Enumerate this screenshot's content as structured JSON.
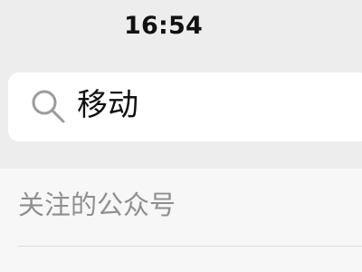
{
  "status_bar": {
    "time": "16:54"
  },
  "search": {
    "query": "移动",
    "icon": "search-icon"
  },
  "results": {
    "section_title": "关注的公众号"
  },
  "colors": {
    "background": "#ededed",
    "search_background": "#ffffff",
    "section_background": "#f7f7f7",
    "muted_text": "#8f8f8f"
  }
}
